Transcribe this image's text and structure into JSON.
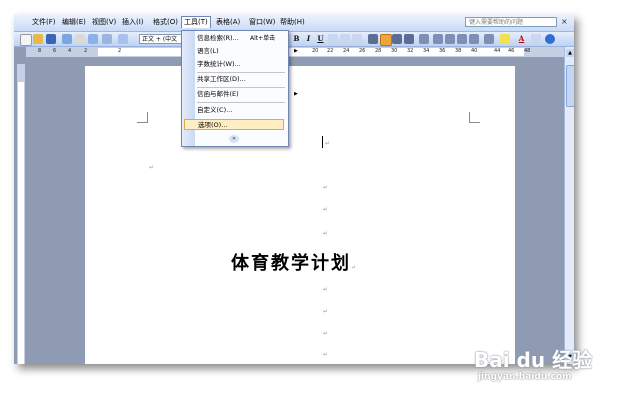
{
  "menubar": {
    "items": [
      "文件(F)",
      "编辑(E)",
      "视图(V)",
      "插入(I)",
      "格式(O)",
      "工具(T)",
      "表格(A)",
      "窗口(W)",
      "帮助(H)"
    ],
    "help_placeholder": "键入需要帮助的问题",
    "close": "×"
  },
  "toolbar": {
    "style_value": "正文 + (中文",
    "bold": "B",
    "italic": "I",
    "underline": "U",
    "font_color_label": "A"
  },
  "ruler": {
    "numbers": [
      "8",
      "6",
      "4",
      "2",
      "2",
      "20",
      "22",
      "24",
      "26",
      "28",
      "30",
      "32",
      "34",
      "36",
      "38",
      "40",
      "44",
      "46",
      "48"
    ]
  },
  "tools_menu": {
    "items": [
      {
        "label": "信息检索(R)...",
        "shortcut": "Alt+单击"
      },
      {
        "label": "语言(L)"
      },
      {
        "label": "字数统计(W)..."
      },
      {
        "label": "共享工作区(D)..."
      },
      {
        "label": "信函与邮件(E)"
      },
      {
        "label": "自定义(C)..."
      },
      {
        "label": "选项(O)..."
      }
    ],
    "more": "»"
  },
  "document": {
    "title": "体育教学计划",
    "para_mark": "↵"
  },
  "watermark": {
    "brand": "Bai du 经验",
    "url": "jingyan.baidu.com"
  },
  "colors": {
    "menu_highlight": "#ffeec2",
    "toolbar": "#c9dbf7",
    "workspace": "#8f9bb3"
  }
}
